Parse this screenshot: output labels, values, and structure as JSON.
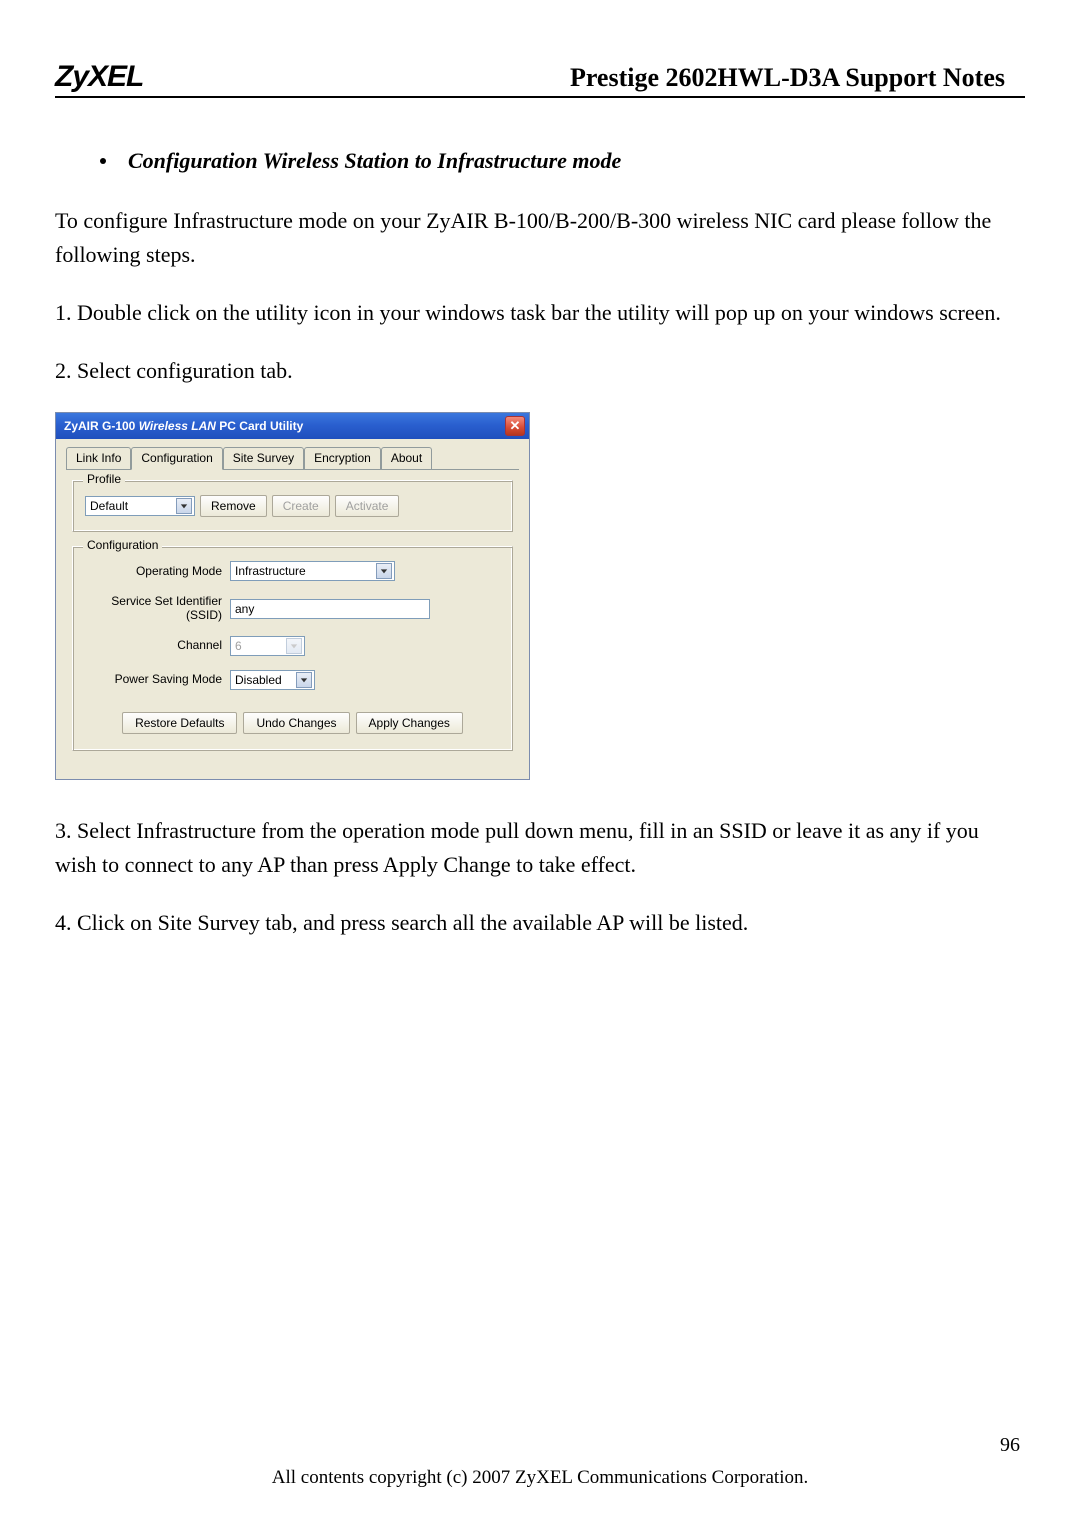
{
  "header": {
    "brand": "ZyXEL",
    "title": "Prestige 2602HWL-D3A Support Notes"
  },
  "section_heading": "Configuration Wireless Station to Infrastructure mode",
  "paragraphs": {
    "intro": "To configure Infrastructure  mode on  your ZyAIR B-100/B-200/B-300 wireless NIC card please follow the following steps.",
    "step1": "1. Double click on the utility icon in your windows task bar the utility will pop up on your windows screen.",
    "step2": "2. Select configuration tab.",
    "step3": "3. Select Infrastructure from the operation mode pull down menu, fill in an SSID or leave it as any if you wish to connect to any AP than press Apply Change to take effect.",
    "step4": "4. Click on Site Survey tab, and press search all the available AP will be listed."
  },
  "dialog": {
    "title_prefix": "ZyAIR G-100",
    "title_mid": "Wireless LAN",
    "title_suffix": "PC Card Utility",
    "tabs": [
      "Link Info",
      "Configuration",
      "Site Survey",
      "Encryption",
      "About"
    ],
    "active_tab_index": 1,
    "profile": {
      "legend": "Profile",
      "selected": "Default",
      "buttons": {
        "remove": "Remove",
        "create": "Create",
        "activate": "Activate"
      }
    },
    "config": {
      "legend": "Configuration",
      "fields": {
        "operating_mode": {
          "label": "Operating Mode",
          "value": "Infrastructure"
        },
        "ssid": {
          "label1": "Service Set Identifier",
          "label2": "(SSID)",
          "value": "any"
        },
        "channel": {
          "label": "Channel",
          "value": "6"
        },
        "power_saving": {
          "label": "Power Saving Mode",
          "value": "Disabled"
        }
      },
      "buttons": {
        "restore": "Restore Defaults",
        "undo": "Undo Changes",
        "apply": "Apply Changes"
      }
    }
  },
  "footer": {
    "page_number": "96",
    "copyright": "All contents copyright (c) 2007 ZyXEL Communications Corporation."
  }
}
